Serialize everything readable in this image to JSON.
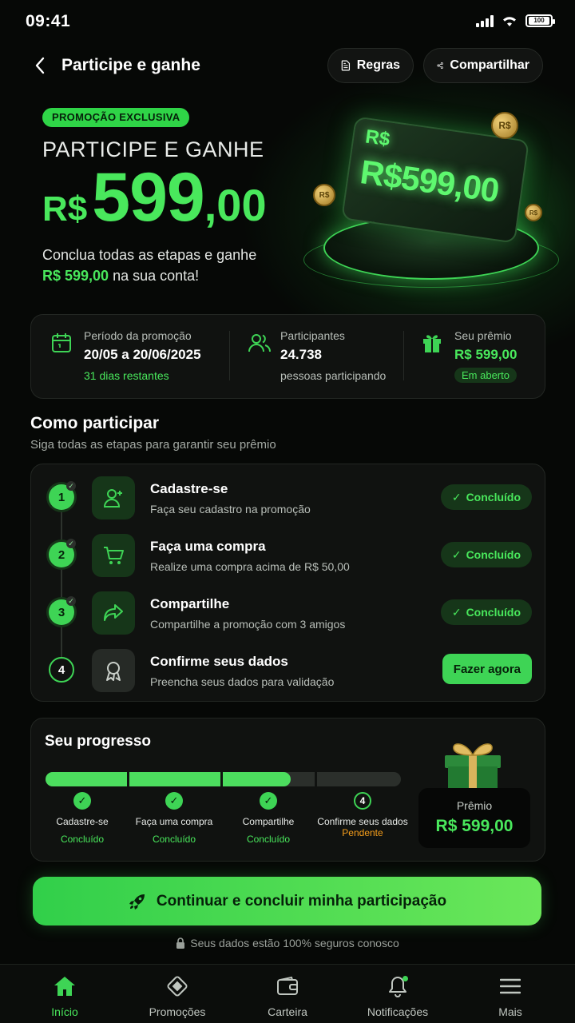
{
  "status_bar": {
    "time": "09:41",
    "battery": "100"
  },
  "header": {
    "title": "Participe e ganhe",
    "rules_label": "Regras",
    "share_label": "Compartilhar"
  },
  "hero": {
    "badge": "PROMOÇÃO EXCLUSIVA",
    "title": "PARTICIPE E GANHE",
    "currency": "R$",
    "amount_main": "599",
    "amount_cents": ",00",
    "desc_line1": "Conclua todas as etapas e ganhe",
    "desc_amount": "R$ 599,00",
    "desc_line2": " na sua conta!",
    "card_currency": "R$",
    "card_amount": "R$599,00",
    "coin_label": "R$"
  },
  "info": {
    "period": {
      "label": "Período da promoção",
      "value": "20/05 a 20/06/2025",
      "sub": "31 dias restantes"
    },
    "participants": {
      "label": "Participantes",
      "value": "24.738",
      "sub": "pessoas participando"
    },
    "prize": {
      "label": "Seu prêmio",
      "value": "R$ 599,00",
      "tag": "Em aberto"
    }
  },
  "how": {
    "title": "Como participar",
    "subtitle": "Siga todas as etapas para garantir seu prêmio"
  },
  "steps": [
    {
      "num": "1",
      "title": "Cadastre-se",
      "desc": "Faça seu cadastro na promoção",
      "status": "Concluído",
      "icon": "user-add-icon"
    },
    {
      "num": "2",
      "title": "Faça uma compra",
      "desc": "Realize uma compra acima de R$ 50,00",
      "status": "Concluído",
      "icon": "cart-icon"
    },
    {
      "num": "3",
      "title": "Compartilhe",
      "desc": "Compartilhe a promoção com 3 amigos",
      "status": "Concluído",
      "icon": "share-arrow-icon"
    },
    {
      "num": "4",
      "title": "Confirme seus dados",
      "desc": "Preencha seus dados para validação",
      "action": "Fazer agora",
      "icon": "award-icon"
    }
  ],
  "progress": {
    "title": "Seu progresso",
    "steps": [
      {
        "name": "Cadastre-se",
        "status": "Concluído"
      },
      {
        "name": "Faça uma compra",
        "status": "Concluído"
      },
      {
        "name": "Compartilhe",
        "status": "Concluído"
      },
      {
        "num": "4",
        "name": "Confirme seus dados",
        "status": "Pendente"
      }
    ],
    "completed_fraction": 0.75,
    "prize_label": "Prêmio",
    "prize_value": "R$ 599,00"
  },
  "cta": {
    "label": "Continuar e concluir minha participação"
  },
  "secure_note": "Seus dados estão 100% seguros conosco",
  "nav": [
    {
      "label": "Início",
      "icon": "home-icon",
      "active": true
    },
    {
      "label": "Promoções",
      "icon": "diamond-tag-icon"
    },
    {
      "label": "Carteira",
      "icon": "wallet-icon"
    },
    {
      "label": "Notificações",
      "icon": "bell-icon"
    },
    {
      "label": "Mais",
      "icon": "menu-icon"
    }
  ],
  "colors": {
    "accent": "#3ed455",
    "accent_text": "#49e85c",
    "pending": "#f59e1b",
    "background": "#060806",
    "card": "#101210"
  }
}
